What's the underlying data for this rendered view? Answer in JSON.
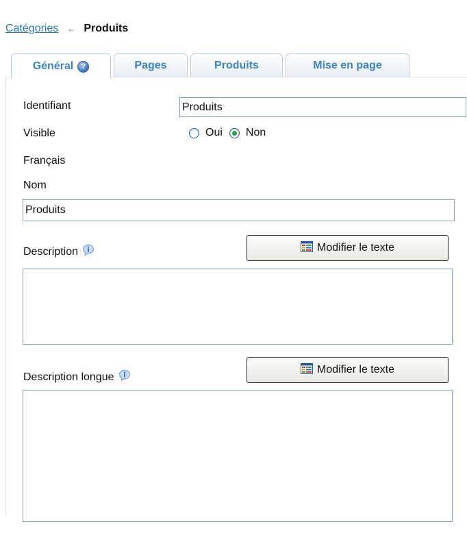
{
  "breadcrumb": {
    "parent": "Catégories",
    "separator": "←",
    "current": "Produits"
  },
  "tabs": [
    {
      "label": "Général",
      "active": true,
      "icon": "help-icon"
    },
    {
      "label": "Pages",
      "active": false
    },
    {
      "label": "Produits",
      "active": false
    },
    {
      "label": "Mise en page",
      "active": false
    }
  ],
  "form": {
    "identifiant": {
      "label": "Identifiant",
      "value": "Produits"
    },
    "visible": {
      "label": "Visible",
      "options": [
        "Oui",
        "Non"
      ],
      "selected": "Non"
    },
    "language_label": "Français",
    "nom": {
      "label": "Nom",
      "value": "Produits"
    },
    "description": {
      "label": "Description",
      "button_label": "Modifier le texte",
      "value": ""
    },
    "description_longue": {
      "label": "Description longue",
      "button_label": "Modifier le texte",
      "value": ""
    }
  },
  "colors": {
    "link": "#2a78c2",
    "tab_text": "#3a83c4",
    "input_border": "#7f9db9",
    "radio_selected": "#27a341"
  }
}
